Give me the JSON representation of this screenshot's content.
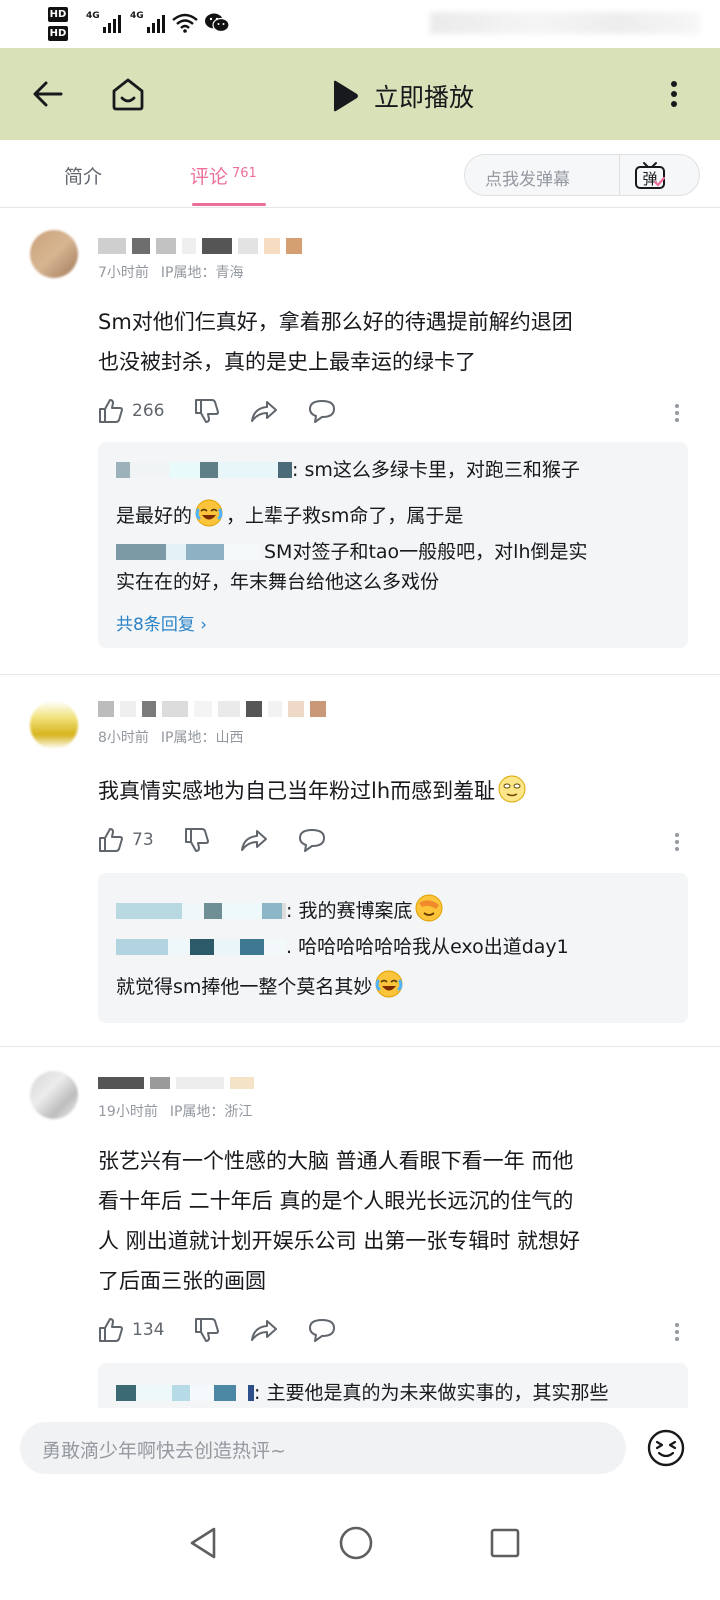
{
  "status_bar": {
    "hd1": "HD",
    "hd2": "HD",
    "net1": "4G",
    "net2": "4G"
  },
  "header": {
    "play_label": "立即播放",
    "back_icon": "back-arrow-icon",
    "home_icon": "home-tv-icon",
    "more_icon": "more-vertical-icon",
    "background": "#d8e1b8"
  },
  "tabs": {
    "intro": "简介",
    "comments": "评论",
    "comment_count": "761",
    "danmaku_placeholder": "点我发弹幕",
    "danmaku_icon_text": "弹",
    "accent": "#ec6f99"
  },
  "comments": [
    {
      "time": "7小时前",
      "ip": "IP属地：青海",
      "text_lines": [
        "Sm对他们仨真好，拿着那么好的待遇提前解约退团",
        "也没被封杀，真的是史上最幸运的绿卡了"
      ],
      "likes": "266",
      "replies": {
        "lines": [
          {
            "text": ": sm这么多绿卡里，对跑三和猴子"
          },
          {
            "text_a": "是最好的",
            "text_b": "，上辈子救sm命了，属于是"
          },
          {
            "text": "SM对签子和tao一般般吧，对lh倒是实"
          },
          {
            "text": "实在在的好，年末舞台给他这么多戏份"
          }
        ],
        "more": "共8条回复"
      }
    },
    {
      "time": "8小时前",
      "ip": "IP属地：山西",
      "text": "我真情实感地为自己当年粉过lh而感到羞耻",
      "likes": "73",
      "replies": {
        "lines": [
          {
            "text": ": 我的赛博案底"
          },
          {
            "text": ". 哈哈哈哈哈哈我从exo出道day1"
          },
          {
            "text": "就觉得sm捧他一整个莫名其妙"
          }
        ]
      }
    },
    {
      "time": "19小时前",
      "ip": "IP属地：浙江",
      "text_lines": [
        "张艺兴有一个性感的大脑 普通人看眼下看一年 而他",
        "看十年后 二十年后 真的是个人眼光长远沉的住气的",
        "人 刚出道就计划开娱乐公司 出第一张专辑时 就想好",
        "了后面三张的画圆"
      ],
      "likes": "134",
      "replies": {
        "lines": [
          {
            "text": ": 主要他是真的为未来做实事的，其实那些"
          }
        ]
      }
    }
  ],
  "bottom_bar": {
    "placeholder": "勇敢滴少年啊快去创造热评~",
    "emoji_icon": "emoji-face-icon"
  },
  "nav_bar": {
    "back_icon": "nav-back-triangle-icon",
    "home_icon": "nav-home-circle-icon",
    "recents_icon": "nav-recents-square-icon"
  }
}
